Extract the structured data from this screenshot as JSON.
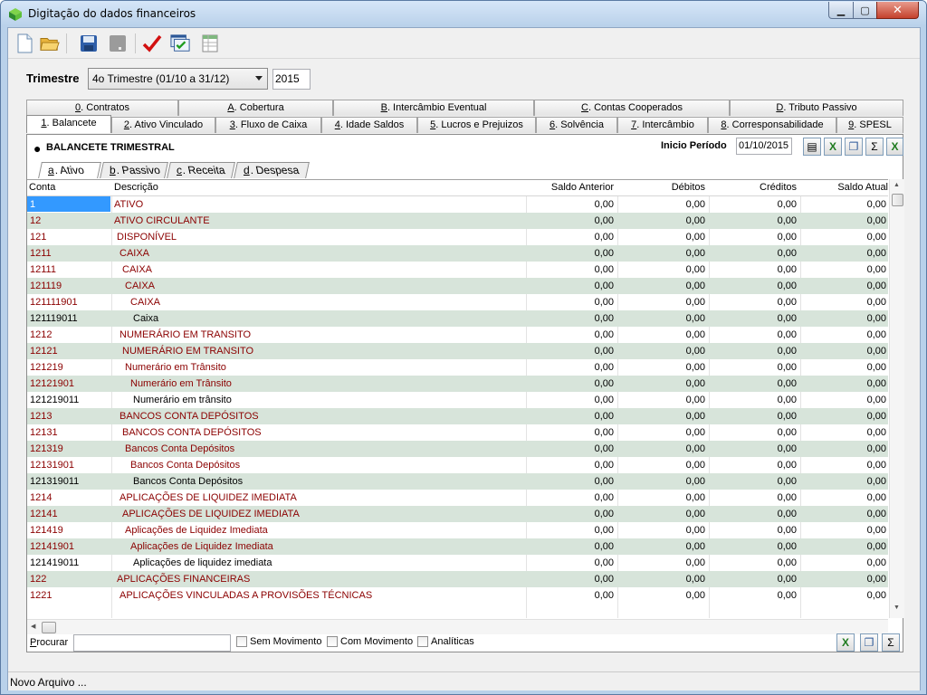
{
  "window": {
    "title": "Digitação do dados financeiros"
  },
  "trimestre": {
    "label": "Trimestre",
    "selected": "4o Trimestre (01/10 a 31/12)",
    "year": "2015"
  },
  "tabs_top": [
    {
      "key": "0",
      "label": ". Contratos"
    },
    {
      "key": "A",
      "label": ". Cobertura"
    },
    {
      "key": "B",
      "label": ". Intercâmbio Eventual"
    },
    {
      "key": "C",
      "label": ". Contas Cooperados"
    },
    {
      "key": "D",
      "label": ". Tributo Passivo"
    }
  ],
  "tabs_main": [
    {
      "key": "1",
      "label": ". Balancete"
    },
    {
      "key": "2",
      "label": ". Ativo Vinculado"
    },
    {
      "key": "3",
      "label": ". Fluxo de Caixa"
    },
    {
      "key": "4",
      "label": ". Idade Saldos"
    },
    {
      "key": "5",
      "label": ". Lucros e Prejuizos"
    },
    {
      "key": "6",
      "label": ". Solvência"
    },
    {
      "key": "7",
      "label": ". Intercâmbio"
    },
    {
      "key": "8",
      "label": ". Corresponsabilidade"
    },
    {
      "key": "9",
      "label": ". SPESL"
    }
  ],
  "panel": {
    "title": "BALANCETE TRIMESTRAL",
    "inicio_label": "Inicio Período",
    "inicio_value": "01/10/2015"
  },
  "subtabs": [
    {
      "key": "a",
      "label": ". Ativo"
    },
    {
      "key": "b",
      "label": ". Passivo"
    },
    {
      "key": "c",
      "label": ". Receita"
    },
    {
      "key": "d",
      "label": ". Despesa"
    }
  ],
  "grid": {
    "headers": {
      "conta": "Conta",
      "descricao": "Descrição",
      "saldo_anterior": "Saldo Anterior",
      "debitos": "Débitos",
      "creditos": "Créditos",
      "saldo_atual": "Saldo Atual"
    },
    "rows": [
      {
        "conta": "1",
        "desc": "ATIVO",
        "level": 0,
        "sa": "0,00",
        "deb": "0,00",
        "cre": "0,00",
        "sat": "0,00"
      },
      {
        "conta": "12",
        "desc": "ATIVO CIRCULANTE",
        "level": 0,
        "sa": "0,00",
        "deb": "0,00",
        "cre": "0,00",
        "sat": "0,00"
      },
      {
        "conta": "121",
        "desc": "DISPONÍVEL",
        "level": 1,
        "sa": "0,00",
        "deb": "0,00",
        "cre": "0,00",
        "sat": "0,00"
      },
      {
        "conta": "1211",
        "desc": "CAIXA",
        "level": 2,
        "sa": "0,00",
        "deb": "0,00",
        "cre": "0,00",
        "sat": "0,00"
      },
      {
        "conta": "12111",
        "desc": "CAIXA",
        "level": 3,
        "sa": "0,00",
        "deb": "0,00",
        "cre": "0,00",
        "sat": "0,00"
      },
      {
        "conta": "121119",
        "desc": "CAIXA",
        "level": 4,
        "sa": "0,00",
        "deb": "0,00",
        "cre": "0,00",
        "sat": "0,00"
      },
      {
        "conta": "121111901",
        "desc": "CAIXA",
        "level": 6,
        "sa": "0,00",
        "deb": "0,00",
        "cre": "0,00",
        "sat": "0,00"
      },
      {
        "conta": "121119011",
        "desc": "Caixa",
        "level": 7,
        "black": true,
        "sa": "0,00",
        "deb": "0,00",
        "cre": "0,00",
        "sat": "0,00"
      },
      {
        "conta": "1212",
        "desc": "NUMERÁRIO EM TRANSITO",
        "level": 2,
        "sa": "0,00",
        "deb": "0,00",
        "cre": "0,00",
        "sat": "0,00"
      },
      {
        "conta": "12121",
        "desc": "NUMERÁRIO EM TRANSITO",
        "level": 3,
        "sa": "0,00",
        "deb": "0,00",
        "cre": "0,00",
        "sat": "0,00"
      },
      {
        "conta": "121219",
        "desc": "Numerário em Trânsito",
        "level": 4,
        "sa": "0,00",
        "deb": "0,00",
        "cre": "0,00",
        "sat": "0,00"
      },
      {
        "conta": "12121901",
        "desc": "Numerário em Trânsito",
        "level": 6,
        "sa": "0,00",
        "deb": "0,00",
        "cre": "0,00",
        "sat": "0,00"
      },
      {
        "conta": "121219011",
        "desc": "Numerário em trânsito",
        "level": 7,
        "black": true,
        "sa": "0,00",
        "deb": "0,00",
        "cre": "0,00",
        "sat": "0,00"
      },
      {
        "conta": "1213",
        "desc": "BANCOS CONTA DEPÓSITOS",
        "level": 2,
        "sa": "0,00",
        "deb": "0,00",
        "cre": "0,00",
        "sat": "0,00"
      },
      {
        "conta": "12131",
        "desc": "BANCOS CONTA DEPÓSITOS",
        "level": 3,
        "sa": "0,00",
        "deb": "0,00",
        "cre": "0,00",
        "sat": "0,00"
      },
      {
        "conta": "121319",
        "desc": "Bancos Conta Depósitos",
        "level": 4,
        "sa": "0,00",
        "deb": "0,00",
        "cre": "0,00",
        "sat": "0,00"
      },
      {
        "conta": "12131901",
        "desc": "Bancos Conta Depósitos",
        "level": 6,
        "sa": "0,00",
        "deb": "0,00",
        "cre": "0,00",
        "sat": "0,00"
      },
      {
        "conta": "121319011",
        "desc": "Bancos Conta Depósitos",
        "level": 7,
        "black": true,
        "sa": "0,00",
        "deb": "0,00",
        "cre": "0,00",
        "sat": "0,00"
      },
      {
        "conta": "1214",
        "desc": "APLICAÇÕES DE LIQUIDEZ IMEDIATA",
        "level": 2,
        "sa": "0,00",
        "deb": "0,00",
        "cre": "0,00",
        "sat": "0,00"
      },
      {
        "conta": "12141",
        "desc": "APLICAÇÕES DE LIQUIDEZ IMEDIATA",
        "level": 3,
        "sa": "0,00",
        "deb": "0,00",
        "cre": "0,00",
        "sat": "0,00"
      },
      {
        "conta": "121419",
        "desc": "Aplicações de Liquidez Imediata",
        "level": 4,
        "sa": "0,00",
        "deb": "0,00",
        "cre": "0,00",
        "sat": "0,00"
      },
      {
        "conta": "12141901",
        "desc": "Aplicações de Liquidez Imediata",
        "level": 6,
        "sa": "0,00",
        "deb": "0,00",
        "cre": "0,00",
        "sat": "0,00"
      },
      {
        "conta": "121419011",
        "desc": "Aplicações de liquidez imediata",
        "level": 7,
        "black": true,
        "sa": "0,00",
        "deb": "0,00",
        "cre": "0,00",
        "sat": "0,00"
      },
      {
        "conta": "122",
        "desc": "APLICAÇÕES FINANCEIRAS",
        "level": 1,
        "sa": "0,00",
        "deb": "0,00",
        "cre": "0,00",
        "sat": "0,00"
      },
      {
        "conta": "1221",
        "desc": "APLICAÇÕES VINCULADAS A PROVISÕES TÉCNICAS",
        "level": 2,
        "sa": "0,00",
        "deb": "0,00",
        "cre": "0,00",
        "sat": "0,00"
      }
    ]
  },
  "search": {
    "label": "Procurar",
    "value": ""
  },
  "filters": [
    {
      "label": "Sem Movimento"
    },
    {
      "label": "Com Movimento"
    },
    {
      "label": "Analíticas"
    }
  ],
  "status": {
    "text": "Novo Arquivo ..."
  },
  "icons": {
    "app": "app-cube-icon",
    "new": "new-file-icon",
    "open": "open-folder-icon",
    "save": "save-disk-icon",
    "disabled": "disabled-icon",
    "check": "checkmark-icon",
    "validate": "validate-window-icon",
    "grid": "grid-sheet-icon",
    "excel": "excel-export-icon",
    "copy": "copy-icon",
    "sum": "sum-icon",
    "doc": "document-icon"
  },
  "colors": {
    "accent_red": "#8b0000",
    "row_stripe": "#d7e4da",
    "selection": "#3399ff",
    "title_blue": "#b9d1ea"
  }
}
